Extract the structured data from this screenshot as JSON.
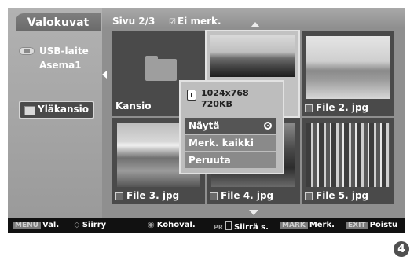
{
  "sidebar": {
    "tab_label": "Valokuvat",
    "device_label": "USB-laite",
    "drive_label": "Asema1",
    "up_folder_label": "Yläkansio"
  },
  "header": {
    "page_label": "Sivu 2/3",
    "mark_filter_label": "Ei merk."
  },
  "grid": {
    "items": [
      {
        "label": "Kansio",
        "type": "folder"
      },
      {
        "label": "",
        "type": "photo"
      },
      {
        "label": "File 2. jpg",
        "type": "photo"
      },
      {
        "label": "File 3. jpg",
        "type": "photo"
      },
      {
        "label": "File 4. jpg",
        "type": "photo"
      },
      {
        "label": "File 5. jpg",
        "type": "photo"
      }
    ]
  },
  "popup": {
    "resolution": "1024x768",
    "size": "720KB",
    "items": [
      {
        "label": "Näytä",
        "selected": true
      },
      {
        "label": "Merk. kaikki",
        "selected": false
      },
      {
        "label": "Peruuta",
        "selected": false
      }
    ]
  },
  "bottom_bar": {
    "hints": [
      {
        "key": "MENU",
        "label": "Val."
      },
      {
        "key": "◇",
        "label": "Siirry"
      },
      {
        "key": "◉",
        "label": "Kohoval."
      },
      {
        "key": "PR",
        "label": "Siirrä s."
      },
      {
        "key": "MARK",
        "label": "Merk."
      },
      {
        "key": "EXIT",
        "label": "Poistu"
      }
    ]
  },
  "page_number": "4"
}
